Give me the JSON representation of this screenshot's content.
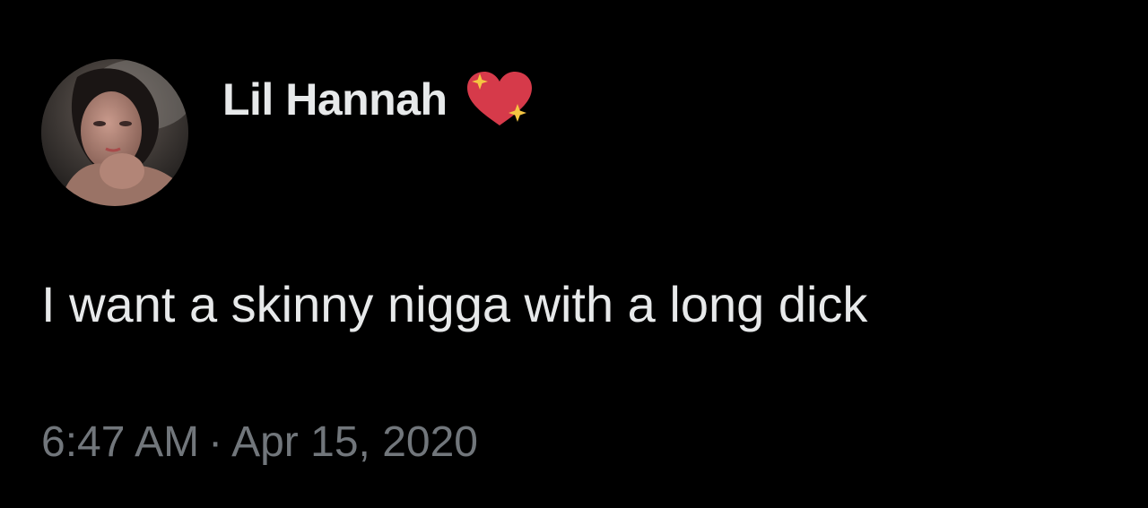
{
  "tweet": {
    "author": {
      "display_name": "Lil Hannah",
      "avatar_icon": "profile-photo",
      "badge_icon": "sparkling-heart-emoji"
    },
    "text": "I want a skinny nigga with a long dick",
    "time": "6:47 AM",
    "separator": "·",
    "date": "Apr 15, 2020"
  },
  "colors": {
    "background": "#000000",
    "text": "#e7e9ea",
    "meta": "#71767b",
    "heart": "#d63a4a",
    "sparkle": "#f5c542"
  }
}
